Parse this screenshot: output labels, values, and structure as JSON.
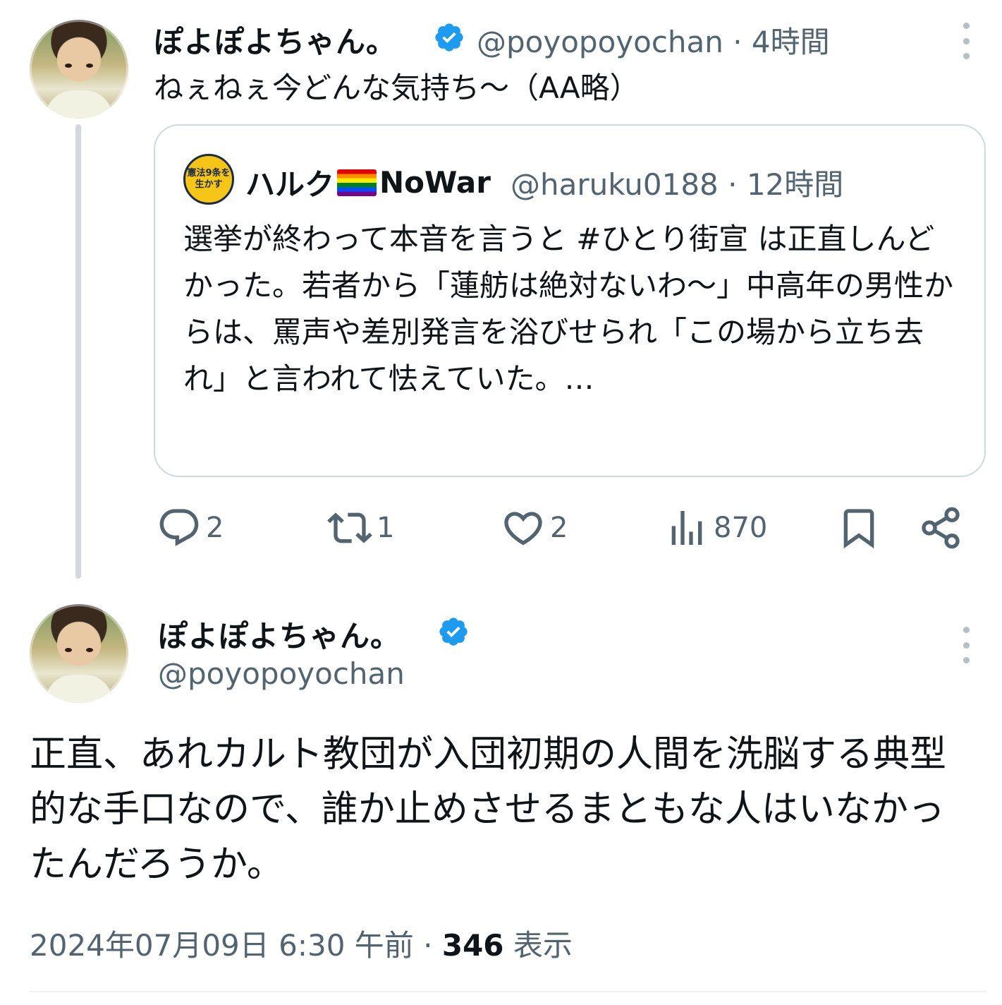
{
  "reply_tweet": {
    "name": "ぽよぽよちゃん。",
    "handle_meta": "@poyopoyochan · 4時間",
    "text": "ねぇねぇ今どんな気持ち～（AA略）",
    "quote": {
      "avatar_text": "憲法9条を生かす",
      "name_prefix": "ハルク",
      "name_suffix": "NoWar",
      "handle_meta": "@haruku0188 · 12時間",
      "text": "選挙が終わって本音を言うと #ひとり街宣 は正直しんどかった。若者から「蓮舫は絶対ないわ～」中高年の男性からは、罵声や差別発言を浴びせられ「この場から立ち去れ」と言われて怯えていた。…"
    },
    "actions": {
      "reply_count": "2",
      "retweet_count": "1",
      "like_count": "2",
      "views_count": "870"
    }
  },
  "main_tweet": {
    "name": "ぽよぽよちゃん。",
    "handle": "@poyopoyochan",
    "text": "正直、あれカルト教団が入団初期の人間を洗脳する典型的な手口なので、誰か止めさせるまともな人はいなかったんだろうか。",
    "timestamp": "2024年07月09日 6:30 午前",
    "views": "346",
    "views_label": "表示"
  },
  "colors": {
    "verified": "#1d9bf0",
    "secondary_text": "#536471",
    "border": "#cfd9de"
  },
  "icons": [
    "verified-badge-icon",
    "more-icon",
    "reply-icon",
    "retweet-icon",
    "like-icon",
    "views-icon",
    "bookmark-icon",
    "share-icon"
  ]
}
